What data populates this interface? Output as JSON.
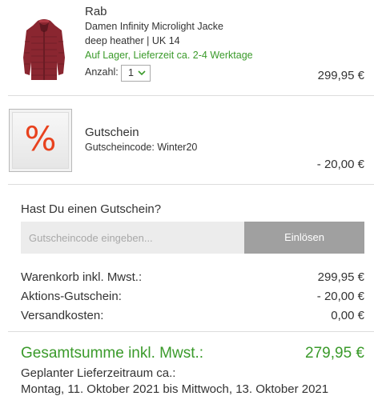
{
  "product": {
    "brand": "Rab",
    "name": "Damen Infinity Microlight Jacke",
    "variant": "deep heather | UK 14",
    "stock": "Auf Lager, Lieferzeit ca. 2-4 Werktage",
    "qty_label": "Anzahl:",
    "qty_value": "1",
    "price": "299,95 €",
    "image": "red-quilted-down-jacket"
  },
  "coupon_item": {
    "icon": "percent-icon",
    "title": "Gutschein",
    "code_text": "Gutscheincode: Winter20",
    "price": "- 20,00 €"
  },
  "voucher": {
    "question": "Hast Du einen Gutschein?",
    "placeholder": "Gutscheincode eingeben...",
    "button": "Einlösen"
  },
  "summary": {
    "cart_label": "Warenkorb inkl. Mwst.:",
    "cart_value": "299,95 €",
    "promo_label": "Aktions-Gutschein:",
    "promo_value": "- 20,00 €",
    "shipping_label": "Versandkosten:",
    "shipping_value": "0,00 €",
    "total_label": "Gesamtsumme inkl. Mwst.:",
    "total_value": "279,95 €",
    "delivery_label": "Geplanter Lieferzeitraum ca.:",
    "delivery_range": "Montag, 11. Oktober 2021 bis Mittwoch, 13. Oktober 2021"
  },
  "colors": {
    "accent_green": "#3a9a2a",
    "percent_red": "#e8421e",
    "button_gray": "#a0a0a0"
  }
}
